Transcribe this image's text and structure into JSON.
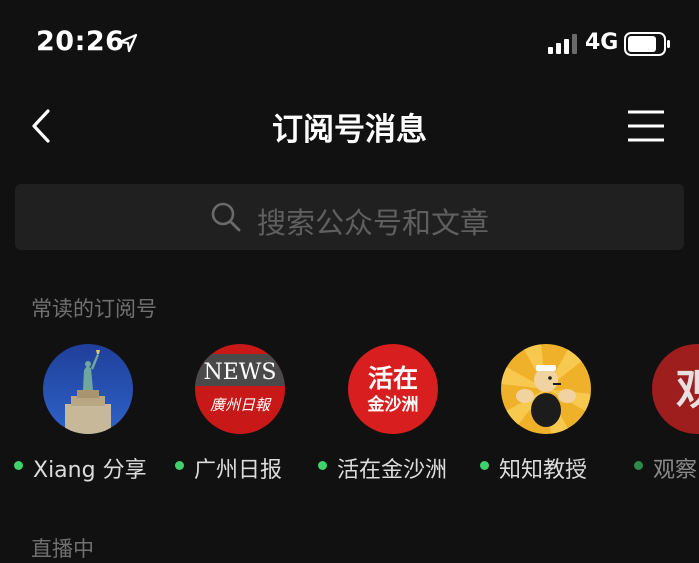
{
  "status_bar": {
    "time": "20:26",
    "network": "4G"
  },
  "nav": {
    "title": "订阅号消息"
  },
  "search": {
    "placeholder": "搜索公众号和文章"
  },
  "frequent": {
    "title": "常读的订阅号",
    "accounts": [
      {
        "name": "Xiang 分享",
        "icon": "statue-of-liberty-avatar"
      },
      {
        "name": "广州日报",
        "icon": "news-avatar",
        "avatar_text": "NEWS",
        "avatar_subtext": "廣州日報"
      },
      {
        "name": "活在金沙洲",
        "icon": "red-circle-avatar",
        "avatar_text_top": "活在",
        "avatar_text_bottom": "金沙洲"
      },
      {
        "name": "知知教授",
        "icon": "popeye-avatar"
      },
      {
        "name": "观察",
        "icon": "red-partial-avatar",
        "avatar_text": "观"
      }
    ]
  },
  "live": {
    "title": "直播中"
  },
  "colors": {
    "background": "#111111",
    "search_bg": "#202020",
    "online_dot": "#3fd26a",
    "section_text": "#707070"
  }
}
